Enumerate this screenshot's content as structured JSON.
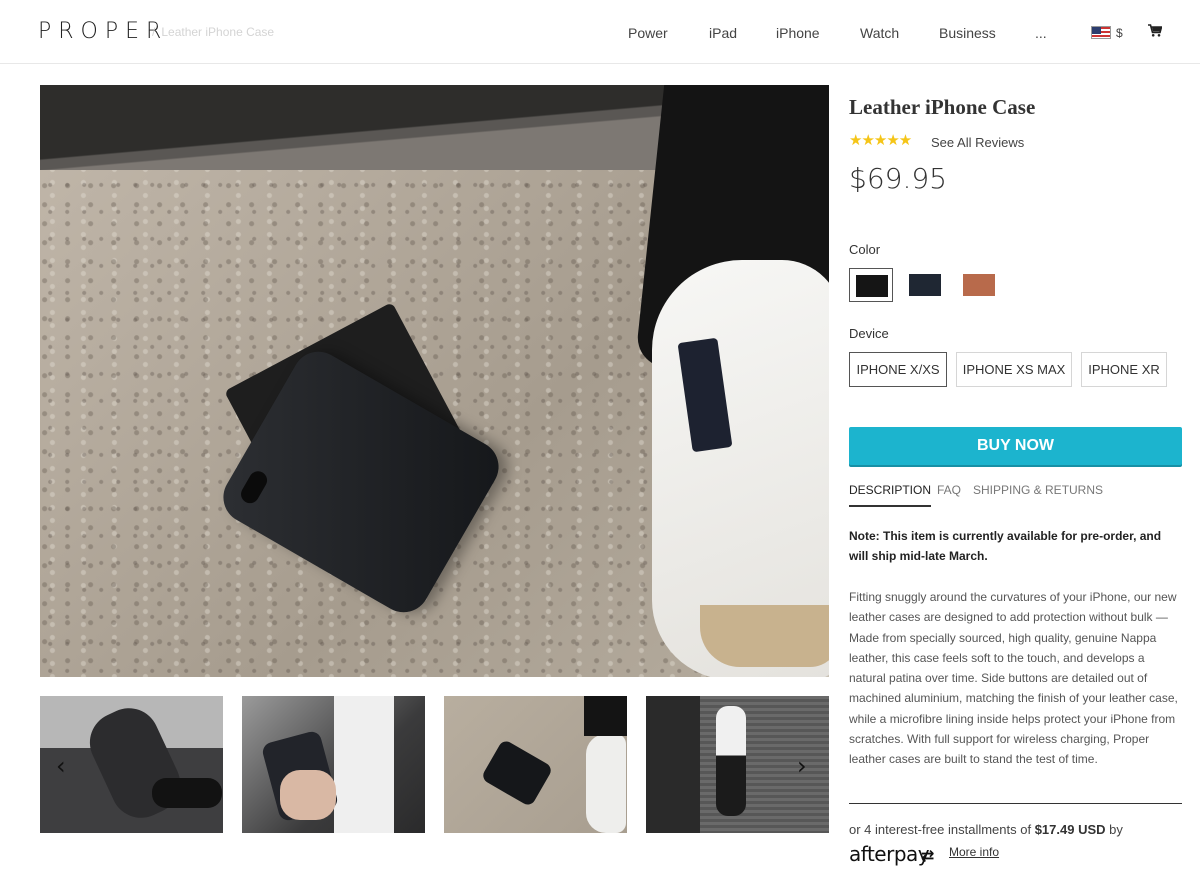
{
  "header": {
    "logo": "PROPER",
    "breadcrumb_sep": "/",
    "breadcrumb": "Leather iPhone Case",
    "nav": [
      "Power",
      "iPad",
      "iPhone",
      "Watch",
      "Business",
      "..."
    ],
    "currency": "$",
    "icons": {
      "flag": "us-flag-icon",
      "cart": "cart-icon"
    }
  },
  "product": {
    "title": "Leather iPhone Case",
    "stars": "★★★★★",
    "rating": 5,
    "reviews_link": "See All Reviews",
    "price": "$69.95",
    "color_label": "Color",
    "colors": [
      {
        "name": "black",
        "hex": "#151515",
        "selected": true
      },
      {
        "name": "navy",
        "hex": "#1f2733",
        "selected": false
      },
      {
        "name": "tan",
        "hex": "#b86a4b",
        "selected": false
      }
    ],
    "device_label": "Device",
    "devices": [
      "IPHONE X/XS",
      "IPHONE XS MAX",
      "IPHONE XR"
    ],
    "selected_device": "IPHONE X/XS",
    "buy_button": "BUY NOW",
    "tabs": [
      "DESCRIPTION",
      "FAQ",
      "SHIPPING & RETURNS"
    ],
    "active_tab": "DESCRIPTION",
    "note": "Note: This item is currently available for pre-order, and will ship mid-late March.",
    "description": "Fitting snuggly around the curvatures of your iPhone, our new leather cases are designed to add protection without bulk — Made from specially sourced, high quality, genuine Nappa leather, this case feels soft to the touch, and develops a natural patina over time. Side buttons are detailed out of machined aluminium, matching the finish of your leather case, while a microfibre lining inside helps protect your iPhone from scratches. With full support for wireless charging, Proper leather cases are built to stand the test of time.",
    "afterpay": {
      "prefix": "or 4 interest-free installments of ",
      "amount": "$17.49 USD",
      "suffix": " by",
      "logo": "afterpay",
      "mark": "⇄",
      "more_info": "More info"
    }
  },
  "gallery": {
    "prev_arrow": "‹",
    "next_arrow": "›",
    "colors": {
      "accent": "#1cb4ce",
      "star": "#f5c518"
    }
  }
}
